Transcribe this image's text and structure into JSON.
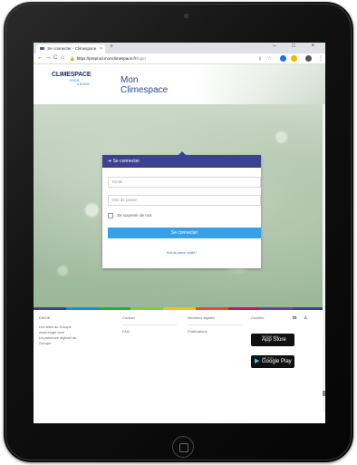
{
  "browser": {
    "tab_title": "Se connecter - Climespace",
    "tab_close": "×",
    "new_tab": "+",
    "window_controls": "– □ ×",
    "nav_back": "←",
    "nav_forward": "→",
    "nav_reload": "C",
    "nav_home": "⌂",
    "url_lock": "🔒",
    "url_host": "https://preprod.monclimespace.fr",
    "url_path": "/login"
  },
  "header": {
    "logo_text": "CLIMESPACE",
    "logo_tag1": "ENGIE",
    "logo_tag2": "a ENGIE",
    "site_title_line1": "Mon",
    "site_title_line2": "Climespace"
  },
  "login": {
    "title": "Se connecter",
    "email_placeholder": "Email",
    "password_placeholder": "Mot de passe",
    "remember_label": "Se souvenir de moi",
    "submit_label": "Se connecter",
    "forgot_link": "Mot de passe oublié?"
  },
  "footer": {
    "stripe_colors": [
      "#3b4390",
      "#1a8fd6",
      "#2aa84a",
      "#8cc63e",
      "#f4c20d",
      "#e64a2b",
      "#c2185b",
      "#6a3fa0",
      "#3b4390"
    ],
    "col1": {
      "title": "ENGIE",
      "items": [
        "Les sites du Groupe",
        "www.engie.com",
        "La présence digitale du",
        "Groupe"
      ]
    },
    "col2": {
      "title": "Contact",
      "items": [
        "FAQ"
      ]
    },
    "col3": {
      "title": "Mentions légales",
      "items": [
        "Publications"
      ]
    },
    "col4": {
      "title": "Cookies"
    },
    "social_in": "in",
    "social_other": "♙",
    "appstore_small": "Download on the",
    "appstore_label": "App Store",
    "googleplay_small": "GET IT ON",
    "googleplay_label": "Google Play"
  }
}
